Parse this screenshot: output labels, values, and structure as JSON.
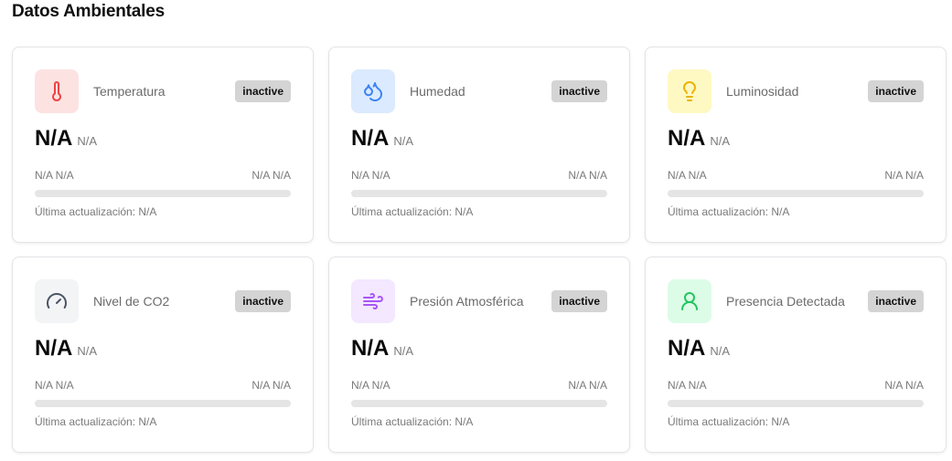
{
  "section": {
    "title": "Datos Ambientales"
  },
  "cards": [
    {
      "name": "Temperatura",
      "icon": "thermometer-icon",
      "icon_bg": "#fde2e2",
      "icon_color": "#ef4444",
      "status": "inactive",
      "value": "N/A",
      "unit": "N/A",
      "range_min": "N/A N/A",
      "range_max": "N/A N/A",
      "progress": 0,
      "last_update": "Última actualización: N/A"
    },
    {
      "name": "Humedad",
      "icon": "droplets-icon",
      "icon_bg": "#dbeafe",
      "icon_color": "#3b82f6",
      "status": "inactive",
      "value": "N/A",
      "unit": "N/A",
      "range_min": "N/A N/A",
      "range_max": "N/A N/A",
      "progress": 0,
      "last_update": "Última actualización: N/A"
    },
    {
      "name": "Luminosidad",
      "icon": "lightbulb-icon",
      "icon_bg": "#fef9c3",
      "icon_color": "#eab308",
      "status": "inactive",
      "value": "N/A",
      "unit": "N/A",
      "range_min": "N/A N/A",
      "range_max": "N/A N/A",
      "progress": 0,
      "last_update": "Última actualización: N/A"
    },
    {
      "name": "Nivel de CO2",
      "icon": "gauge-icon",
      "icon_bg": "#f3f4f6",
      "icon_color": "#4b5563",
      "status": "inactive",
      "value": "N/A",
      "unit": "N/A",
      "range_min": "N/A N/A",
      "range_max": "N/A N/A",
      "progress": 0,
      "last_update": "Última actualización: N/A"
    },
    {
      "name": "Presión Atmosférica",
      "icon": "wind-icon",
      "icon_bg": "#f3e8ff",
      "icon_color": "#a855f7",
      "status": "inactive",
      "value": "N/A",
      "unit": "N/A",
      "range_min": "N/A N/A",
      "range_max": "N/A N/A",
      "progress": 0,
      "last_update": "Última actualización: N/A"
    },
    {
      "name": "Presencia Detectada",
      "icon": "user-icon",
      "icon_bg": "#dcfce7",
      "icon_color": "#22c55e",
      "status": "inactive",
      "value": "N/A",
      "unit": "N/A",
      "range_min": "N/A N/A",
      "range_max": "N/A N/A",
      "progress": 0,
      "last_update": "Última actualización: N/A"
    }
  ]
}
